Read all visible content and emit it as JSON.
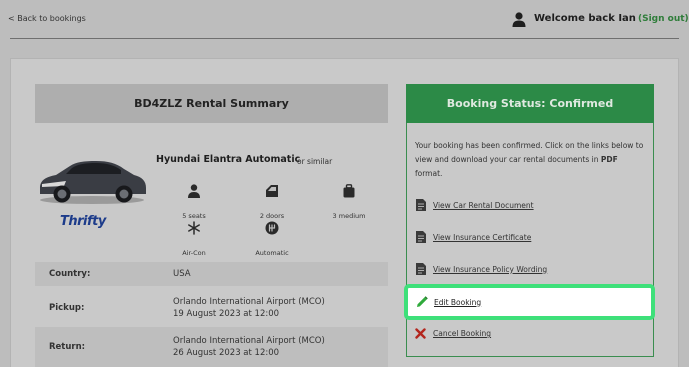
{
  "header": {
    "back_label": "< Back to bookings",
    "welcome": "Welcome back Ian",
    "signout": "(Sign out)"
  },
  "summary": {
    "title": "BD4ZLZ Rental Summary",
    "car_name": "Hyundai Elantra Automatic",
    "similar": "or similar",
    "brand": "Thrifty",
    "features": [
      {
        "icon": "person-icon",
        "label": "5 seats"
      },
      {
        "icon": "door-icon",
        "label": "2 doors"
      },
      {
        "icon": "luggage-icon",
        "label": "3 medium"
      },
      {
        "icon": "snowflake-icon",
        "label": "Air-Con"
      },
      {
        "icon": "gearbox-icon",
        "label": "Automatic"
      }
    ],
    "details": [
      {
        "key": "Country:",
        "value": "USA"
      },
      {
        "key": "Pickup:",
        "value": "Orlando International Airport (MCO)",
        "value2": "19 August 2023 at 12:00"
      },
      {
        "key": "Return:",
        "value": "Orlando International Airport (MCO)",
        "value2": "26 August 2023 at 12:00"
      }
    ]
  },
  "status": {
    "title": "Booking Status: Confirmed",
    "message_before": "Your booking has been confirmed. Click on the links below to view and download your car rental documents in ",
    "message_bold": "PDF",
    "message_after": " format.",
    "links": [
      {
        "label": "View Car Rental Document",
        "icon": "document-icon"
      },
      {
        "label": "View Insurance Certificate",
        "icon": "document-icon"
      },
      {
        "label": "View Insurance Policy Wording",
        "icon": "document-icon"
      }
    ],
    "edit_label": "Edit Booking",
    "cancel_label": "Cancel Booking"
  },
  "colors": {
    "status_green": "#2c8a47",
    "highlight_green": "#3ee07a",
    "cancel_red": "#b3261e",
    "brand_blue": "#1c3b8a"
  }
}
